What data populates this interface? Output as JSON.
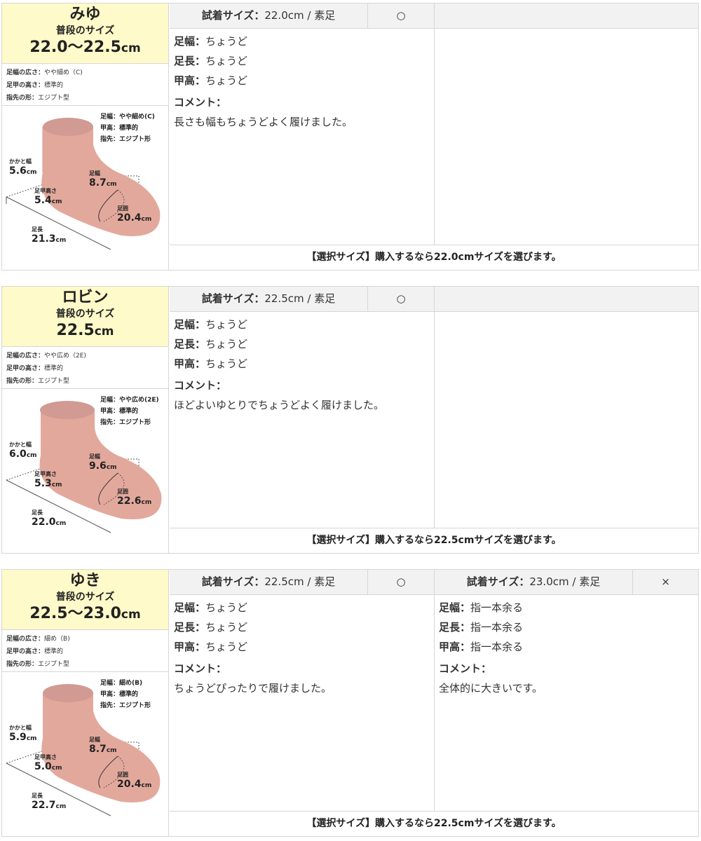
{
  "reviewers": [
    {
      "name": "みゆ",
      "usual_size_label": "普段のサイズ",
      "usual_size_value": "22.0〜22.5",
      "usual_size_unit": "cm",
      "attrs": [
        {
          "key": "足幅の広さ：",
          "value": "やや細め（C)"
        },
        {
          "key": "足甲の高さ：",
          "value": "標準的"
        },
        {
          "key": "指先の形：",
          "value": "エジプト型"
        }
      ],
      "diagram_notes": [
        "足幅：やや細め(C)",
        "甲高：標準的",
        "指先：エジプト形"
      ],
      "measurements": {
        "heel_width": {
          "label": "かかと幅",
          "value": "5.6",
          "unit": "cm"
        },
        "foot_width": {
          "label": "足幅",
          "value": "8.7",
          "unit": "cm"
        },
        "instep_height": {
          "label": "足甲高さ",
          "value": "5.4",
          "unit": "cm"
        },
        "girth": {
          "label": "足囲",
          "value": "20.4",
          "unit": "cm"
        },
        "length": {
          "label": "足長",
          "value": "21.3",
          "unit": "cm"
        }
      },
      "trials": [
        {
          "size_key": "試着サイズ：",
          "size_value": "22.0cm / 素足",
          "mark": "○",
          "rows": [
            {
              "key": "足幅：",
              "value": "ちょうど"
            },
            {
              "key": "足長：",
              "value": "ちょうど"
            },
            {
              "key": "甲高：",
              "value": "ちょうど"
            }
          ],
          "comment_label": "コメント：",
          "comment": "長さも幅もちょうどよく履けました。"
        }
      ],
      "selection": "【選択サイズ】購入するなら22.0cmサイズを選びます。"
    },
    {
      "name": "ロビン",
      "usual_size_label": "普段のサイズ",
      "usual_size_value": "22.5",
      "usual_size_unit": "cm",
      "attrs": [
        {
          "key": "足幅の広さ：",
          "value": "やや広め（2E)"
        },
        {
          "key": "足甲の高さ：",
          "value": "標準的"
        },
        {
          "key": "指先の形：",
          "value": "エジプト型"
        }
      ],
      "diagram_notes": [
        "足幅：やや広め(2E)",
        "甲高：標準的",
        "指先：エジプト形"
      ],
      "measurements": {
        "heel_width": {
          "label": "かかと幅",
          "value": "6.0",
          "unit": "cm"
        },
        "foot_width": {
          "label": "足幅",
          "value": "9.6",
          "unit": "cm"
        },
        "instep_height": {
          "label": "足甲高さ",
          "value": "5.3",
          "unit": "cm"
        },
        "girth": {
          "label": "足囲",
          "value": "22.6",
          "unit": "cm"
        },
        "length": {
          "label": "足長",
          "value": "22.0",
          "unit": "cm"
        }
      },
      "trials": [
        {
          "size_key": "試着サイズ：",
          "size_value": "22.5cm / 素足",
          "mark": "○",
          "rows": [
            {
              "key": "足幅：",
              "value": "ちょうど"
            },
            {
              "key": "足長：",
              "value": "ちょうど"
            },
            {
              "key": "甲高：",
              "value": "ちょうど"
            }
          ],
          "comment_label": "コメント：",
          "comment": "ほどよいゆとりでちょうどよく履けました。"
        }
      ],
      "selection": "【選択サイズ】購入するなら22.5cmサイズを選びます。"
    },
    {
      "name": "ゆき",
      "usual_size_label": "普段のサイズ",
      "usual_size_value": "22.5〜23.0",
      "usual_size_unit": "cm",
      "attrs": [
        {
          "key": "足幅の広さ：",
          "value": "細め（B)"
        },
        {
          "key": "足甲の高さ：",
          "value": "標準的"
        },
        {
          "key": "指先の形：",
          "value": "エジプト型"
        }
      ],
      "diagram_notes": [
        "足幅：細め(B)",
        "甲高：標準的",
        "指先：エジプト形"
      ],
      "measurements": {
        "heel_width": {
          "label": "かかと幅",
          "value": "5.9",
          "unit": "cm"
        },
        "foot_width": {
          "label": "足幅",
          "value": "8.7",
          "unit": "cm"
        },
        "instep_height": {
          "label": "足甲高さ",
          "value": "5.0",
          "unit": "cm"
        },
        "girth": {
          "label": "足囲",
          "value": "20.4",
          "unit": "cm"
        },
        "length": {
          "label": "足長",
          "value": "22.7",
          "unit": "cm"
        }
      },
      "trials": [
        {
          "size_key": "試着サイズ：",
          "size_value": "22.5cm / 素足",
          "mark": "○",
          "rows": [
            {
              "key": "足幅：",
              "value": "ちょうど"
            },
            {
              "key": "足長：",
              "value": "ちょうど"
            },
            {
              "key": "甲高：",
              "value": "ちょうど"
            }
          ],
          "comment_label": "コメント：",
          "comment": "ちょうどぴったりで履けました。"
        },
        {
          "size_key": "試着サイズ：",
          "size_value": "23.0cm / 素足",
          "mark": "×",
          "rows": [
            {
              "key": "足幅：",
              "value": "指一本余る"
            },
            {
              "key": "足長：",
              "value": "指一本余る"
            },
            {
              "key": "甲高：",
              "value": "指一本余る"
            }
          ],
          "comment_label": "コメント：",
          "comment": "全体的に大きいです。"
        }
      ],
      "selection": "【選択サイズ】購入するなら22.5cmサイズを選びます。"
    }
  ],
  "colors": {
    "header_yellow": "#fefac9",
    "head_gray": "#f2f2f2",
    "foot_fill": "#e3a89c",
    "foot_ankle": "#d19a92",
    "border": "#d6d6d6"
  }
}
